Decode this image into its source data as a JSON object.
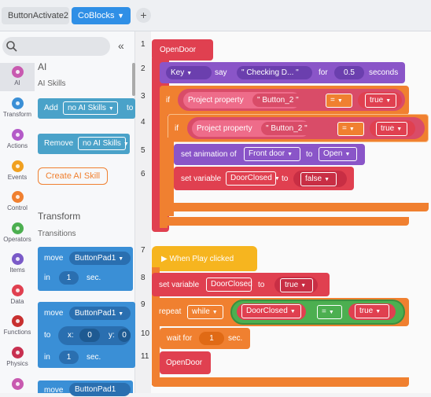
{
  "tabs": [
    {
      "label": "ButtonActivate2"
    },
    {
      "label": "CoBlocks"
    }
  ],
  "sidebar": {
    "categories": [
      {
        "label": "AI",
        "color": "#c85ab0"
      },
      {
        "label": "Transform",
        "color": "#3a8fd6"
      },
      {
        "label": "Actions",
        "color": "#b45ac8"
      },
      {
        "label": "Events",
        "color": "#f0a020"
      },
      {
        "label": "Control",
        "color": "#f08030"
      },
      {
        "label": "Operators",
        "color": "#4caf50"
      },
      {
        "label": "Items",
        "color": "#7a5ac8"
      },
      {
        "label": "Data",
        "color": "#e04050"
      },
      {
        "label": "Functions",
        "color": "#c83030"
      },
      {
        "label": "Physics",
        "color": "#c83050"
      }
    ],
    "ai_heading": "AI",
    "ai_sub": "AI Skills",
    "add_label": "Add",
    "add_select": "no AI Skills",
    "add_to": "to",
    "remove_label": "Remove",
    "remove_select": "no AI Skills",
    "create_ai": "Create AI Skill",
    "transform_heading": "Transform",
    "transform_sub": "Transitions",
    "move1": {
      "label": "move",
      "target": "ButtonPad1",
      "in": "in",
      "num": "1",
      "sec": "sec."
    },
    "move2": {
      "label": "move",
      "target": "ButtonPad1",
      "to": "to",
      "x_label": "x:",
      "x": "0",
      "y_label": "y:",
      "y": "0",
      "in": "in",
      "num": "1",
      "sec": "sec."
    },
    "move3": {
      "label": "move",
      "target": "ButtonPad1"
    }
  },
  "script": {
    "line_numbers": [
      "1",
      "2",
      "3",
      "4",
      "5",
      "6",
      "7",
      "8",
      "9",
      "10",
      "11"
    ],
    "opendoor": "OpenDoor",
    "say": {
      "key": "Key",
      "say": "say",
      "text": "\" Checking D... \"",
      "for": "for",
      "value": "0.5",
      "seconds": "seconds"
    },
    "if1": {
      "if": "if",
      "prop": "Project property",
      "name": "\" Button_2 \"",
      "op": "=",
      "val": "true"
    },
    "if2": {
      "if": "if",
      "prop": "Project property",
      "name": "\" Button_2 \"",
      "op": "=",
      "val": "true"
    },
    "anim": {
      "label": "set animation of",
      "obj": "Front door",
      "to": "to",
      "val": "Open"
    },
    "setvar1": {
      "label": "set variable",
      "var": "DoorClosed",
      "to": "to",
      "val": "false"
    },
    "play": "When Play clicked",
    "setvar2": {
      "label": "set variable",
      "var": "DoorClosed",
      "to": "to",
      "val": "true"
    },
    "repeat": {
      "label": "repeat",
      "mode": "while",
      "var": "DoorClosed",
      "op": "=",
      "val": "true"
    },
    "wait": {
      "label": "wait for",
      "value": "1",
      "sec": "sec."
    },
    "call": "OpenDoor"
  }
}
